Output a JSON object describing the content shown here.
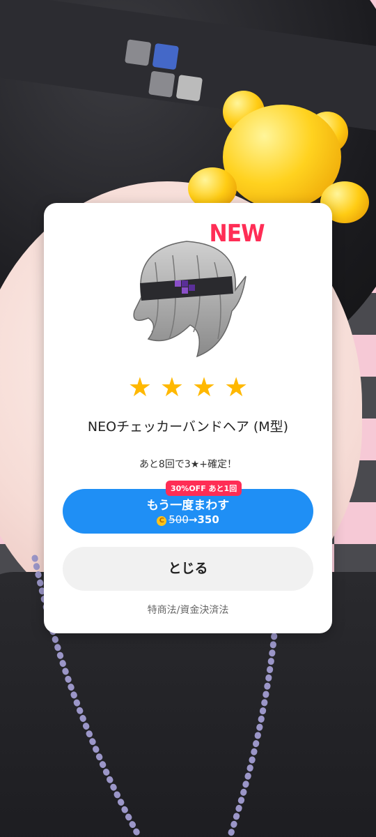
{
  "dialog": {
    "new_badge": "NEW",
    "item_name": "NEOチェッカーバンドヘア (M型)",
    "rarity_stars": 4,
    "star_glyph": "★",
    "guarantee_text": "あと8回で3★+確定！",
    "respin": {
      "discount_badge": "30%OFF あと1回",
      "label": "もう一度まわす",
      "old_price": "500",
      "arrow": "→",
      "new_price": "350",
      "coin_icon": "coin-icon"
    },
    "close_label": "とじる",
    "legal_link": "特商法/資金決済法"
  },
  "colors": {
    "accent_blue": "#1f8ff5",
    "badge_red": "#ff2d55",
    "star_gold": "#ffb800"
  }
}
